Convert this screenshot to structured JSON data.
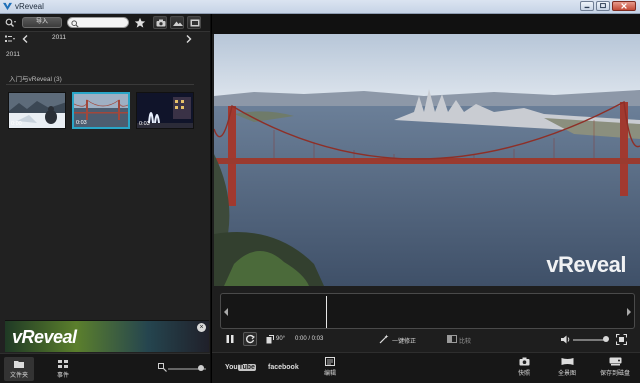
{
  "window": {
    "title": "vReveal",
    "controls": [
      "minimize",
      "maximize",
      "close"
    ]
  },
  "colors": {
    "selection": "#2aa6c8",
    "panel": "#212121",
    "toolbar": "#1a1a1a"
  },
  "library": {
    "toolbar": {
      "import_label": "导入",
      "search_placeholder": "",
      "icons": [
        "search-options-icon",
        "star-icon",
        "camera-filter-icon",
        "landscape-filter-icon",
        "film-filter-icon"
      ]
    },
    "nav": {
      "year": "2011",
      "prev_icon": "chevron-left-icon",
      "next_icon": "chevron-right-icon"
    },
    "year_heading": "2011",
    "collection_label": "入门与vReveal (3)",
    "thumbnails": [
      {
        "name": "snow-clip",
        "duration": "0:00"
      },
      {
        "name": "golden-gate-clip",
        "duration": "0:03",
        "selected": true
      },
      {
        "name": "night-fountain-clip",
        "duration": "0:03"
      }
    ],
    "promo": {
      "brand": "vReveal",
      "close_icon": "close-circle-icon"
    },
    "bottom_tabs": [
      {
        "label": "文件夹",
        "icon": "folder-icon",
        "active": true
      },
      {
        "label": "事件",
        "icon": "grid-icon",
        "active": false
      }
    ],
    "zoom_icon": "zoom-icon"
  },
  "player": {
    "watermark": "vReveal",
    "controls": {
      "rotate_label": "90°",
      "time": "0:00 / 0:03",
      "one_click_fix": "一键修正",
      "compare": "比较"
    },
    "share": {
      "youtube_you": "You",
      "youtube_tube": "Tube",
      "facebook": "facebook",
      "edit": "编辑"
    },
    "actions": [
      {
        "label": "快照",
        "icon": "camera-icon"
      },
      {
        "label": "全景图",
        "icon": "panorama-icon"
      },
      {
        "label": "保存到磁盘",
        "icon": "save-disk-icon"
      }
    ]
  }
}
